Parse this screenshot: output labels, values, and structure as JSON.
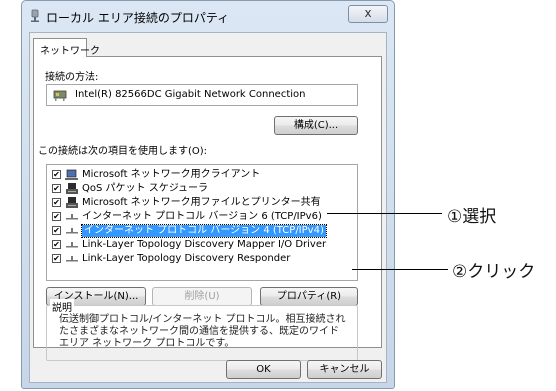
{
  "window": {
    "title": "ローカル エリア接続のプロパティ",
    "close_glyph": "x"
  },
  "tabs": [
    {
      "label": "ネットワーク"
    }
  ],
  "connect_using": {
    "label": "接続の方法:",
    "adapter": "Intel(R) 82566DC Gigabit Network Connection",
    "configure_button": "構成(C)..."
  },
  "items_label": "この接続は次の項目を使用します(O):",
  "items": [
    {
      "label": "Microsoft ネットワーク用クライアント",
      "checked": true,
      "icon": "network-client-icon"
    },
    {
      "label": "QoS パケット スケジューラ",
      "checked": true,
      "icon": "service-icon"
    },
    {
      "label": "Microsoft ネットワーク用ファイルとプリンター共有",
      "checked": true,
      "icon": "service-icon"
    },
    {
      "label": "インターネット プロトコル バージョン 6 (TCP/IPv6)",
      "checked": true,
      "icon": "protocol-icon"
    },
    {
      "label": "インターネット プロトコル バージョン 4 (TCP/IPv4)",
      "checked": true,
      "icon": "protocol-icon",
      "selected": true
    },
    {
      "label": "Link-Layer Topology Discovery Mapper I/O Driver",
      "checked": true,
      "icon": "protocol-icon"
    },
    {
      "label": "Link-Layer Topology Discovery Responder",
      "checked": true,
      "icon": "protocol-icon"
    }
  ],
  "buttons": {
    "install": "インストール(N)...",
    "uninstall": "削除(U)",
    "properties": "プロパティ(R)",
    "ok": "OK",
    "cancel": "キャンセル"
  },
  "description": {
    "legend": "説明",
    "text": "伝送制御プロトコル/インターネット プロトコル。相互接続されたさまざまなネットワーク間の通信を提供する、既定のワイド エリア ネットワーク プロトコルです。"
  },
  "annotations": {
    "step1": "①選択",
    "step2": "②クリック"
  },
  "colors": {
    "selection": "#3399ff",
    "titlebar": "#dbe7f4"
  }
}
